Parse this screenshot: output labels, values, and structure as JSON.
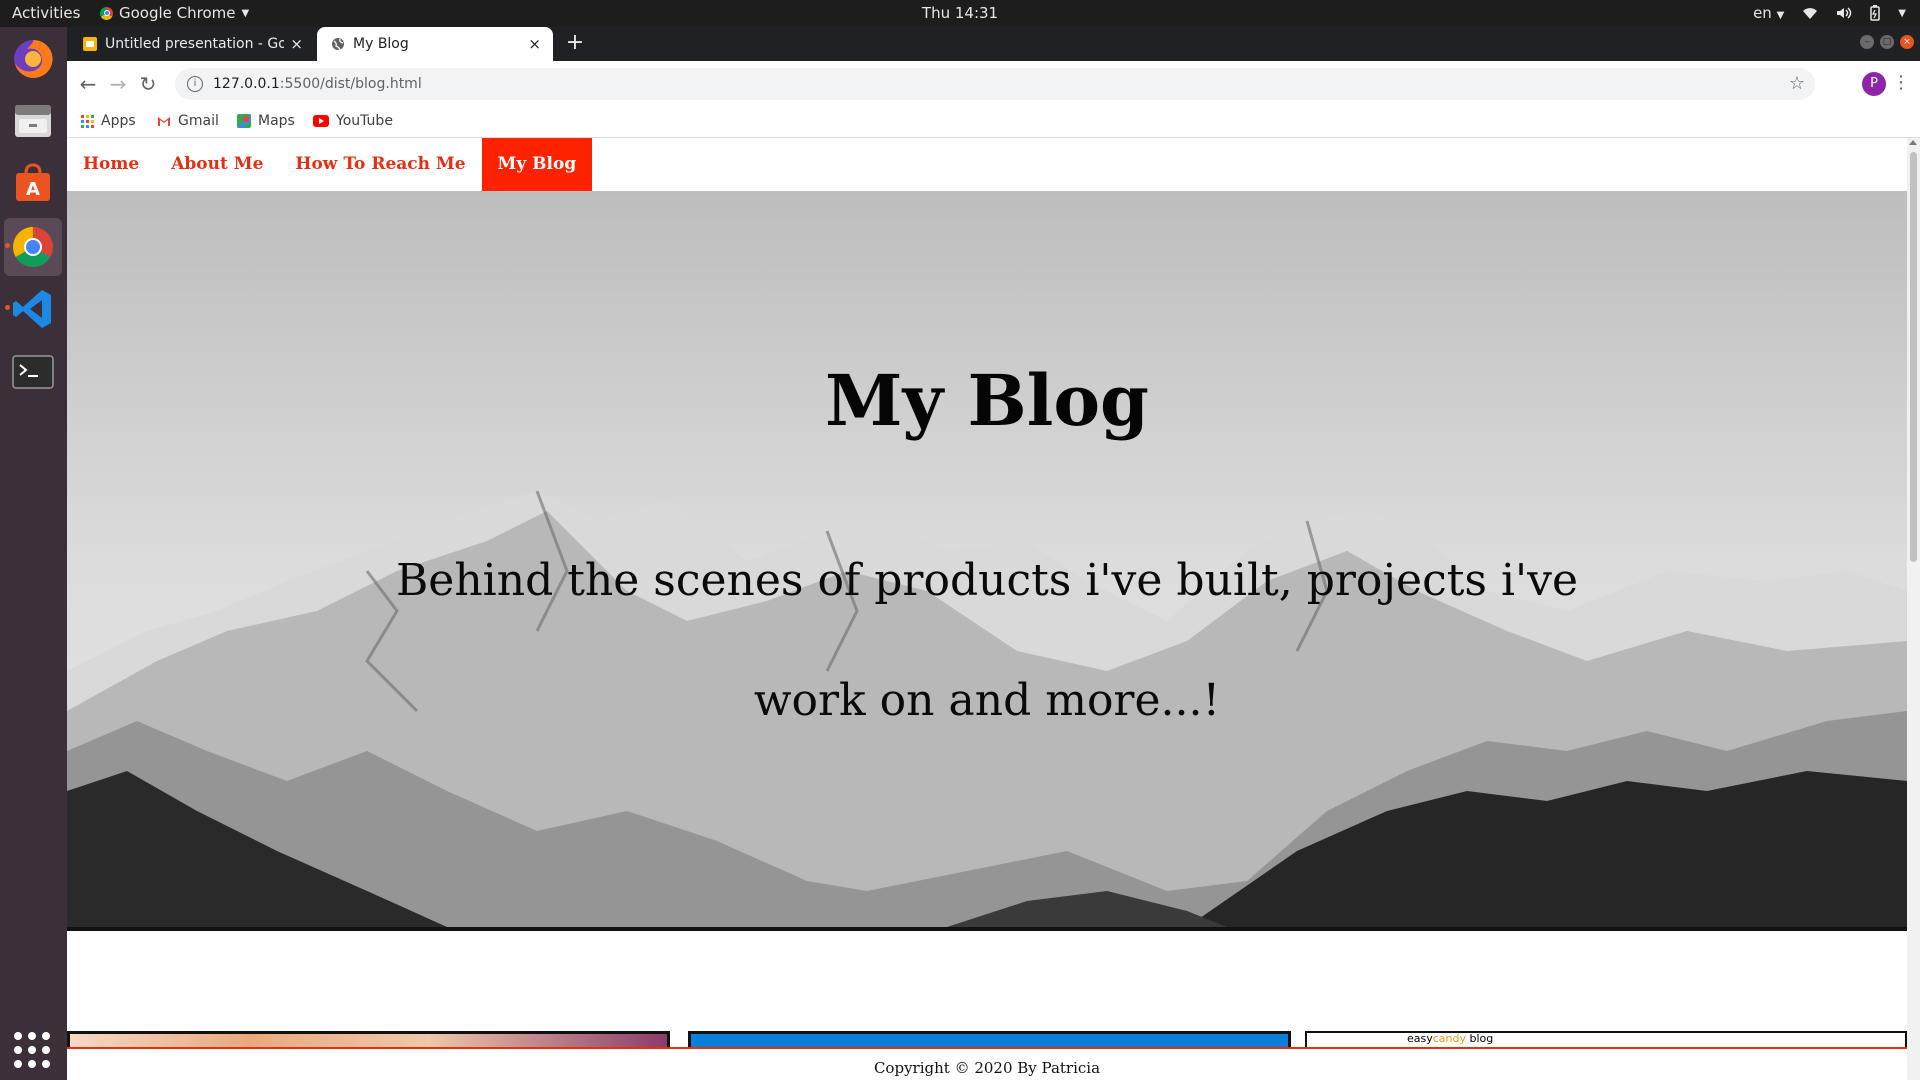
{
  "topbar": {
    "activities": "Activities",
    "app_name": "Google Chrome",
    "clock": "Thu 14:31",
    "lang": "en"
  },
  "browser": {
    "tabs": [
      {
        "title": "Untitled presentation - Google Slides",
        "close": "×"
      },
      {
        "title": "My Blog",
        "close": "×"
      }
    ],
    "new_tab": "+",
    "url_host": "127.0.0.1",
    "url_path": ":5500/dist/blog.html",
    "profile_initial": "P",
    "bookmarks": [
      {
        "label": "Apps",
        "icon": "apps-grid-icon"
      },
      {
        "label": "Gmail",
        "icon": "gmail-icon"
      },
      {
        "label": "Maps",
        "icon": "maps-icon"
      },
      {
        "label": "YouTube",
        "icon": "youtube-icon"
      }
    ]
  },
  "site": {
    "nav": [
      "Home",
      "About Me",
      "How To Reach Me",
      "My Blog"
    ],
    "active_nav": "My Blog",
    "hero_title": "My Blog",
    "hero_subtitle": "Behind the scenes of products i've built, projects i've work on and more...!",
    "card3_text_a": "easy",
    "card3_text_b": "candy",
    "card3_text_c": " blog",
    "footer": "Copyright © 2020 By Patricia"
  },
  "colors": {
    "accent": "#e62e12",
    "active_nav_bg": "#ff2200",
    "ubuntu_orange": "#e95420",
    "profile": "#8e24aa"
  }
}
